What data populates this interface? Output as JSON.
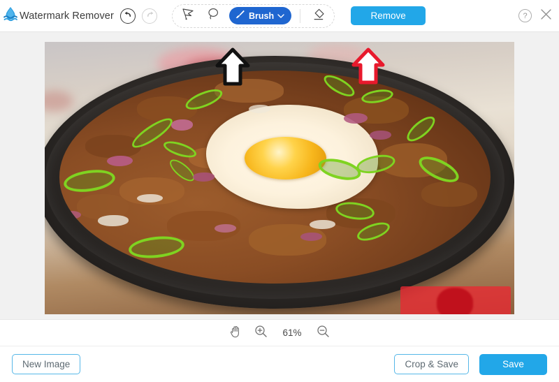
{
  "app": {
    "title": "Watermark Remover",
    "logo_icon": "water-drop-icon"
  },
  "toolbar": {
    "undo_icon": "undo-arrow-icon",
    "redo_icon": "redo-arrow-icon",
    "tools": [
      {
        "name": "polygonal-lasso",
        "icon": "polygonal-lasso-icon"
      },
      {
        "name": "free-lasso",
        "icon": "free-lasso-icon"
      }
    ],
    "brush": {
      "label": "Brush",
      "icon": "brush-icon",
      "chevron": "chevron-down-icon",
      "selected": true
    },
    "eraser_icon": "eraser-icon",
    "remove_label": "Remove",
    "help_label": "?",
    "close_icon": "close-icon"
  },
  "zoombar": {
    "pan_icon": "hand-pan-icon",
    "zoom_in_icon": "zoom-in-icon",
    "zoom_level": "61%",
    "zoom_out_icon": "zoom-out-icon"
  },
  "footer": {
    "new_image_label": "New Image",
    "crop_save_label": "Crop & Save",
    "save_label": "Save"
  },
  "annotations": [
    {
      "name": "arrow-pointing-to-brush",
      "color": "#111111"
    },
    {
      "name": "arrow-pointing-to-remove",
      "color": "#e8192c"
    }
  ],
  "colors": {
    "accent": "#22a7e8",
    "brush_selected": "#1f66d0",
    "mask_red": "#eb2832",
    "canvas_bg": "#f1f1f1"
  }
}
